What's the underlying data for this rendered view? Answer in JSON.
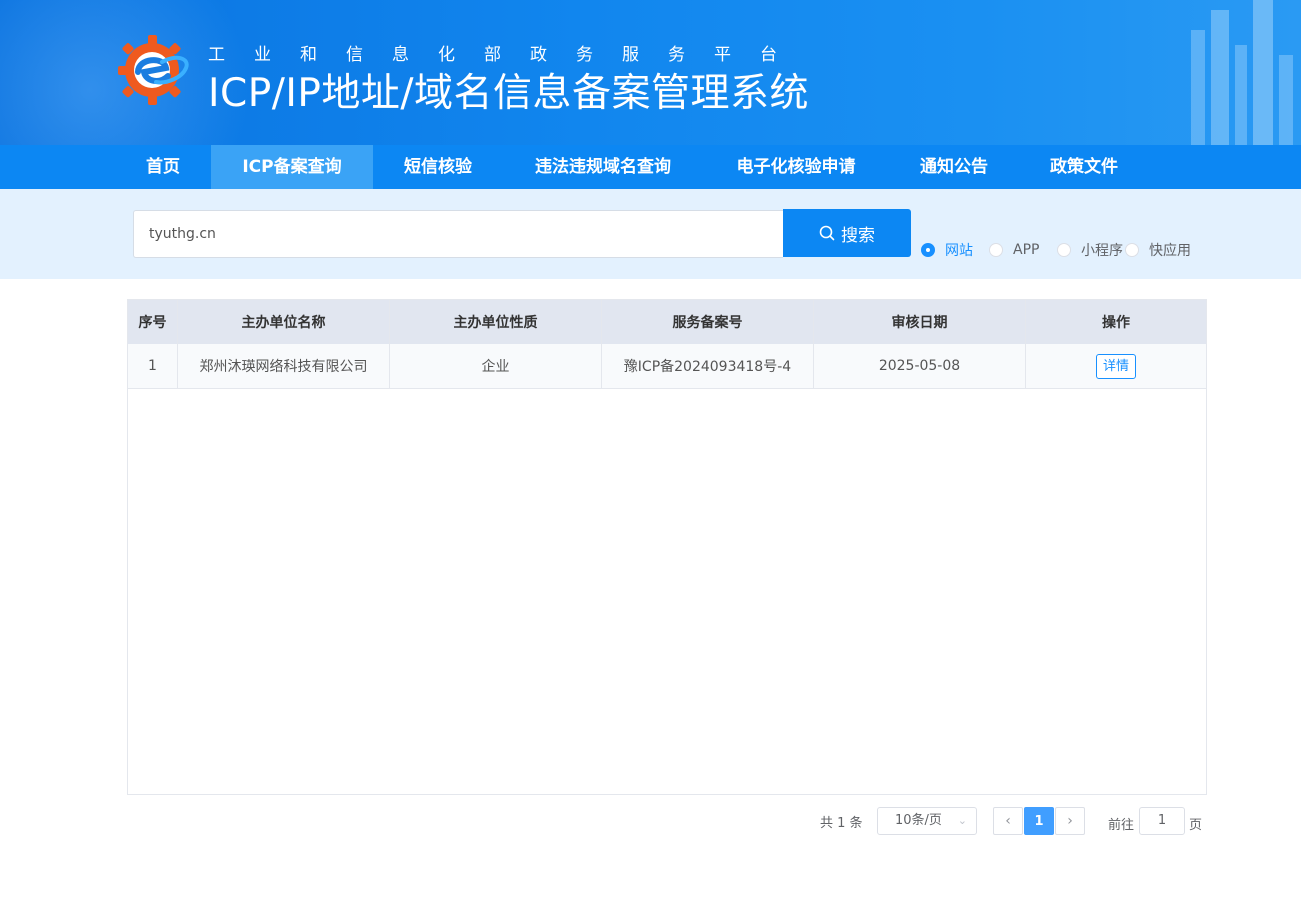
{
  "header": {
    "subtitle": "工业和信息化部政务服务平台",
    "title": "ICP/IP地址/域名信息备案管理系统"
  },
  "nav": {
    "items": [
      {
        "label": "首页"
      },
      {
        "label": "ICP备案查询"
      },
      {
        "label": "短信核验"
      },
      {
        "label": "违法违规域名查询"
      },
      {
        "label": "电子化核验申请"
      },
      {
        "label": "通知公告"
      },
      {
        "label": "政策文件"
      }
    ],
    "active": "ICP备案查询"
  },
  "search": {
    "value": "tyuthg.cn",
    "button_label": "搜索",
    "types": [
      {
        "label": "网站",
        "checked": true
      },
      {
        "label": "APP",
        "checked": false
      },
      {
        "label": "小程序",
        "checked": false
      },
      {
        "label": "快应用",
        "checked": false
      }
    ]
  },
  "table": {
    "headers": [
      "序号",
      "主办单位名称",
      "主办单位性质",
      "服务备案号",
      "审核日期",
      "操作"
    ],
    "rows": [
      {
        "index": "1",
        "org_name": "郑州沐瑛网络科技有限公司",
        "org_type": "企业",
        "record_no": "豫ICP备2024093418号-4",
        "date": "2025-05-08",
        "action": "详情"
      }
    ]
  },
  "pagination": {
    "total": "共 1 条",
    "page_size": "10条/页",
    "current_page": "1",
    "goto_prefix": "前往",
    "goto_value": "1",
    "goto_suffix": "页"
  },
  "colors": {
    "brand_blue": "#0c87f3",
    "active_tab": "#3aa3f6",
    "link_blue": "#1890ff"
  }
}
